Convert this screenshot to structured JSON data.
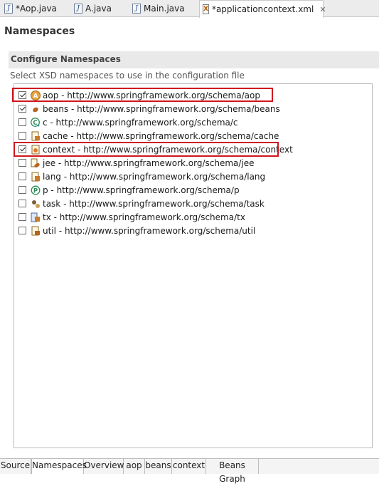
{
  "editor_tabs": [
    {
      "label": "*Aop.java",
      "icon": "java-file-icon"
    },
    {
      "label": "A.java",
      "icon": "java-file-icon"
    },
    {
      "label": "Main.java",
      "icon": "java-file-icon"
    },
    {
      "label": "*applicationcontext.xml",
      "icon": "xml-file-icon",
      "active": true
    }
  ],
  "page": {
    "title": "Namespaces",
    "section_title": "Configure Namespaces",
    "description": "Select XSD namespaces to use in the configuration file"
  },
  "namespaces": [
    {
      "text": "aop - http://www.springframework.org/schema/aop",
      "checked": true,
      "icon": "aop-icon",
      "highlighted": true
    },
    {
      "text": "beans - http://www.springframework.org/schema/beans",
      "checked": true,
      "icon": "beans-icon"
    },
    {
      "text": "c - http://www.springframework.org/schema/c",
      "checked": false,
      "icon": "c-namespace-icon"
    },
    {
      "text": "cache - http://www.springframework.org/schema/cache",
      "checked": false,
      "icon": "cache-icon"
    },
    {
      "text": "context - http://www.springframework.org/schema/context",
      "checked": true,
      "icon": "context-icon",
      "highlighted": true
    },
    {
      "text": "jee - http://www.springframework.org/schema/jee",
      "checked": false,
      "icon": "jee-icon"
    },
    {
      "text": "lang - http://www.springframework.org/schema/lang",
      "checked": false,
      "icon": "lang-icon"
    },
    {
      "text": "p - http://www.springframework.org/schema/p",
      "checked": false,
      "icon": "p-namespace-icon"
    },
    {
      "text": "task - http://www.springframework.org/schema/task",
      "checked": false,
      "icon": "task-icon"
    },
    {
      "text": "tx - http://www.springframework.org/schema/tx",
      "checked": false,
      "icon": "tx-icon"
    },
    {
      "text": "util - http://www.springframework.org/schema/util",
      "checked": false,
      "icon": "util-icon"
    }
  ],
  "bottom_tabs": [
    {
      "label": "Source"
    },
    {
      "label": "Namespaces",
      "active": true
    },
    {
      "label": "Overview"
    },
    {
      "label": "aop"
    },
    {
      "label": "beans"
    },
    {
      "label": "context"
    },
    {
      "label": "Beans Graph"
    }
  ],
  "colors": {
    "highlight_box": "#d0151f",
    "section_bg": "#e9e9e9"
  }
}
